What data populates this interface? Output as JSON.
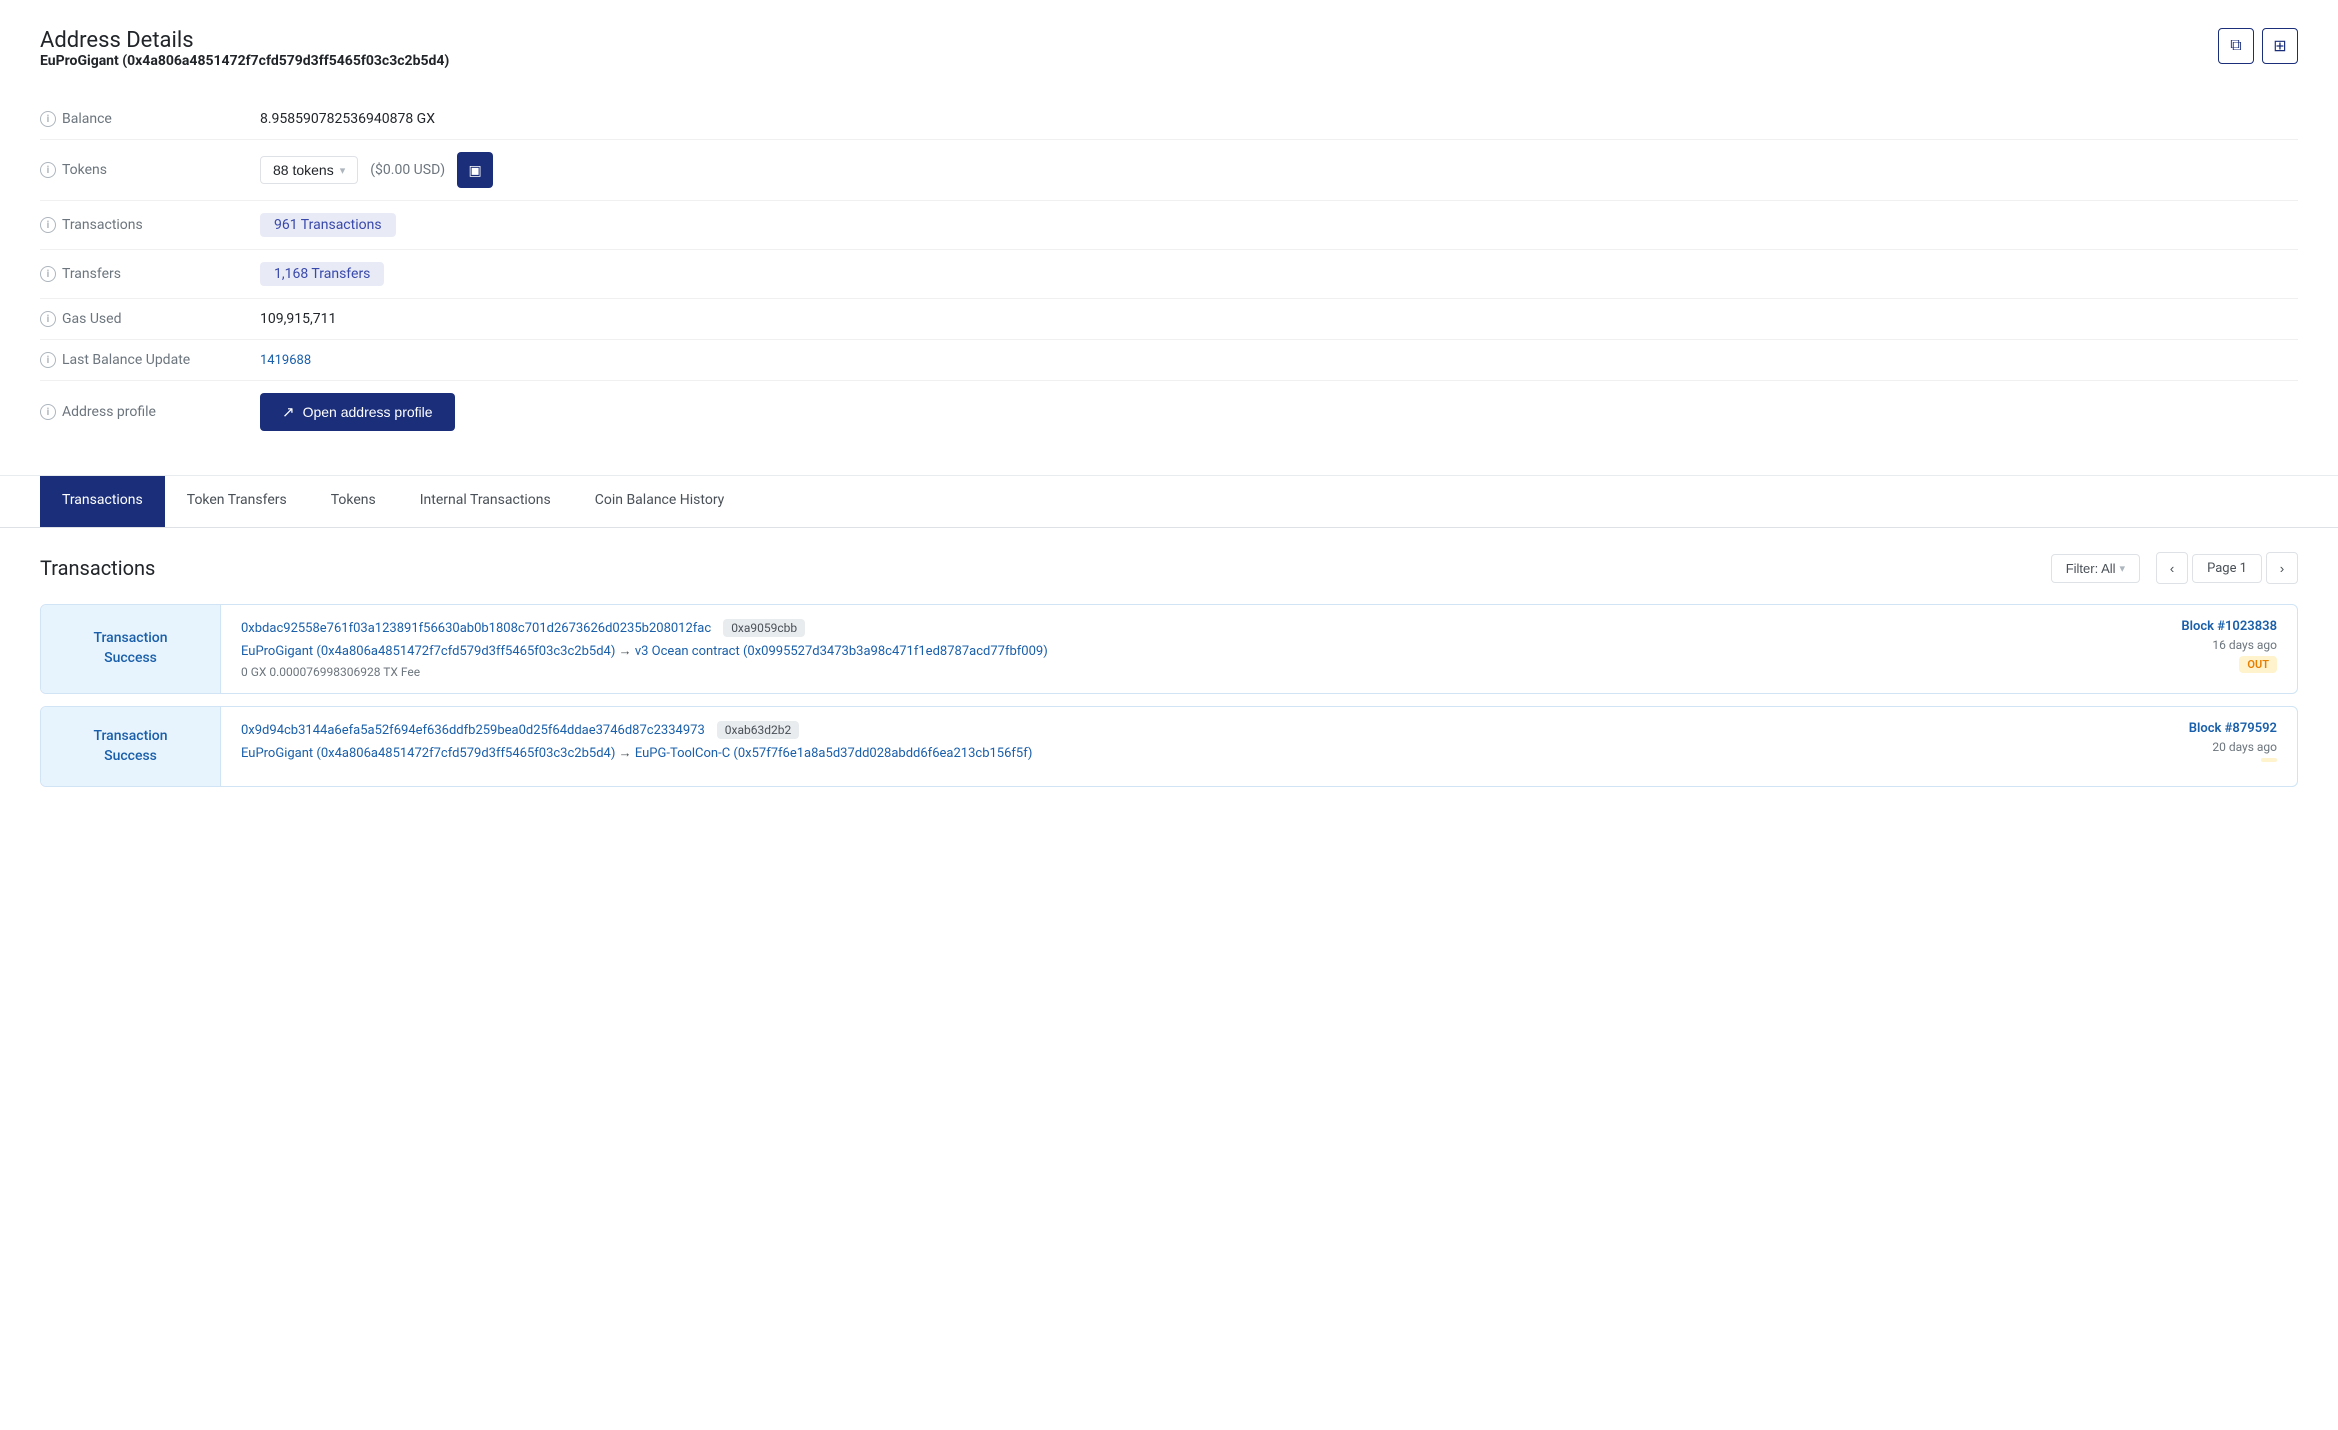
{
  "page": {
    "title": "Address Details",
    "subtitle": "EuProGigant (0x4a806a4851472f7cfd579d3ff5465f03c3c2b5d4)"
  },
  "details": {
    "balance_label": "Balance",
    "balance_value": "8.958590782536940878 GX",
    "tokens_label": "Tokens",
    "tokens_value": "88 tokens",
    "tokens_usd": "($0.00 USD)",
    "transactions_label": "Transactions",
    "transactions_value": "961 Transactions",
    "transfers_label": "Transfers",
    "transfers_value": "1,168 Transfers",
    "gas_label": "Gas Used",
    "gas_value": "109,915,711",
    "last_balance_label": "Last Balance Update",
    "last_balance_value": "1419688",
    "address_profile_label": "Address profile",
    "open_profile_btn": "Open address profile"
  },
  "tabs": [
    {
      "label": "Transactions",
      "active": true
    },
    {
      "label": "Token Transfers",
      "active": false
    },
    {
      "label": "Tokens",
      "active": false
    },
    {
      "label": "Internal Transactions",
      "active": false
    },
    {
      "label": "Coin Balance History",
      "active": false
    }
  ],
  "transactions_section": {
    "title": "Transactions",
    "filter_label": "Filter: All",
    "page_label": "Page 1"
  },
  "transactions": [
    {
      "status": "Transaction\nSuccess",
      "hash": "0xbdac92558e761f03a123891f56630ab0b1808c701d2673626d0235b208012fac",
      "method": "0xa9059cbb",
      "from": "EuProGigant (0x4a806a4851472f7cfd579d3ff5465f03c3c2b5d4)",
      "arrow": "→",
      "to": "v3 Ocean contract (0x0995527d3473b3a98c471f1ed8787acd77fbf009)",
      "fee": "0 GX 0.000076998306928 TX Fee",
      "block": "Block #1023838",
      "time": "16 days ago",
      "direction": "OUT"
    },
    {
      "status": "Transaction\nSuccess",
      "hash": "0x9d94cb3144a6efa5a52f694ef636ddfb259bea0d25f64ddae3746d87c2334973",
      "method": "0xab63d2b2",
      "from": "EuProGigant (0x4a806a4851472f7cfd579d3ff5465f03c3c2b5d4)",
      "arrow": "→",
      "to": "EuPG-ToolCon-C (0x57f7f6e1a8a5d37dd028abdd6f6ea213cb156f5f)",
      "fee": "",
      "block": "Block #879592",
      "time": "20 days ago",
      "direction": ""
    }
  ],
  "icons": {
    "copy": "⧉",
    "grid": "⊞",
    "wallet": "▣",
    "external_link": "↗",
    "chevron_down": "▾",
    "chevron_left": "‹",
    "chevron_right": "›",
    "info": "i"
  }
}
